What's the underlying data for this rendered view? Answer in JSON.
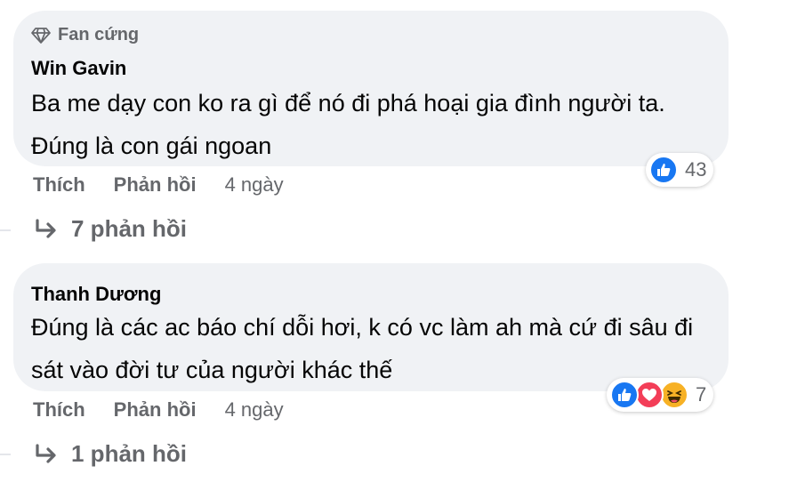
{
  "comments": [
    {
      "badge": "Fan cứng",
      "author": "Win Gavin",
      "text": "Ba me dạy con ko ra gì để nó đi phá hoại gia đình người ta. Đúng là con gái ngoan",
      "like_label": "Thích",
      "reply_label": "Phản hồi",
      "time": "4 ngày",
      "reaction_count": "43",
      "reactions": [
        "like-icon"
      ],
      "replies_label": "7 phản hồi"
    },
    {
      "author": "Thanh Dương",
      "text": "Đúng là các ac báo chí dỗi hơi, k có vc làm ah mà cứ đi sâu đi sát vào đời tư của người khác thế",
      "like_label": "Thích",
      "reply_label": "Phản hồi",
      "time": "4 ngày",
      "reaction_count": "7",
      "reactions": [
        "like-icon",
        "love-icon",
        "haha-icon"
      ],
      "replies_label": "1 phản hồi"
    }
  ],
  "colors": {
    "bubble": "#f0f2f5",
    "secondary_text": "#65676b",
    "like_blue": "#1877f2",
    "love_red": "#f33e58",
    "haha_yellow": "#f7b125"
  }
}
